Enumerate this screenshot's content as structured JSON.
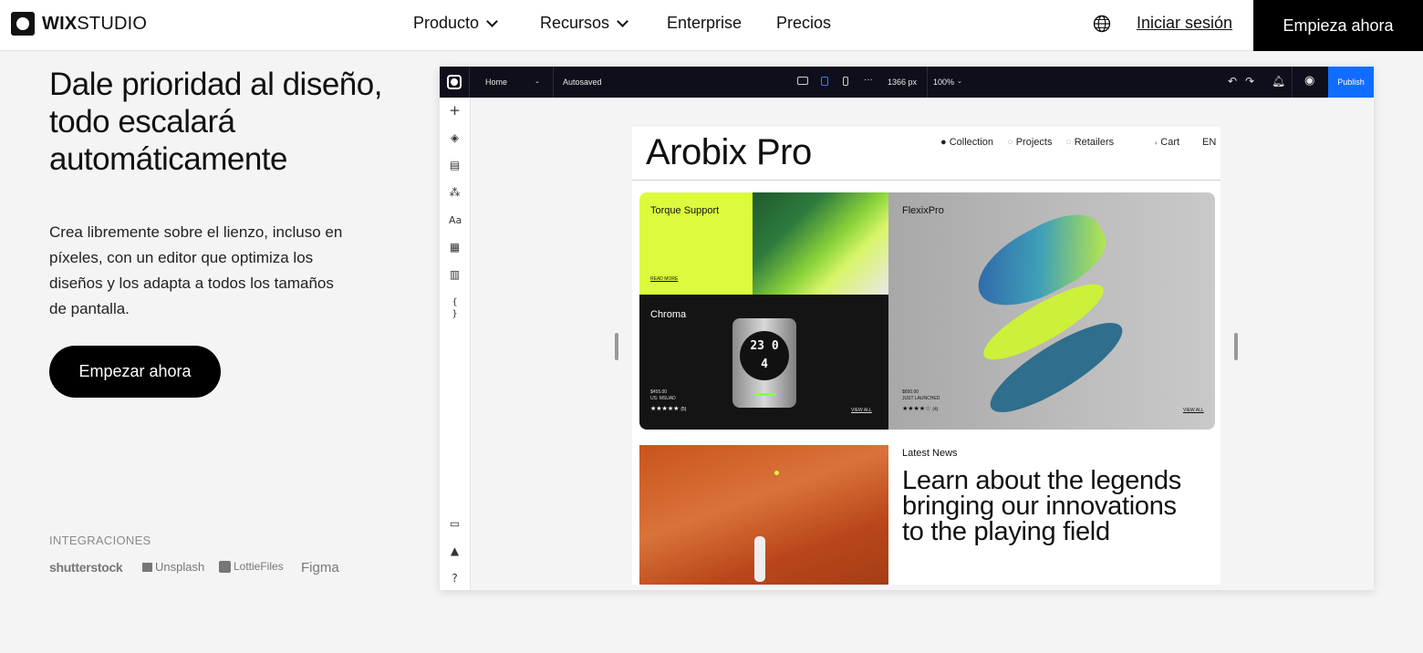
{
  "nav": {
    "logo_bold": "WIX",
    "logo_light": "STUDIO",
    "items": [
      {
        "label": "Producto",
        "has_dropdown": true
      },
      {
        "label": "Recursos",
        "has_dropdown": true
      },
      {
        "label": "Enterprise",
        "has_dropdown": false
      },
      {
        "label": "Precios",
        "has_dropdown": false
      }
    ],
    "login": "Iniciar sesión",
    "cta": "Empieza ahora"
  },
  "hero": {
    "title": "Dale prioridad al diseño, todo escalará automáticamente",
    "description": "Crea libremente sobre el lienzo, incluso en píxeles, con un editor que optimiza los diseños y los adapta a todos los tamaños de pantalla.",
    "button": "Empezar ahora"
  },
  "integrations": {
    "label": "INTEGRACIONES",
    "logos": [
      "shutterstock",
      "Unsplash",
      "LottieFiles",
      "Figma"
    ]
  },
  "editor": {
    "page": "Home",
    "status": "Autosaved",
    "width": "1366 px",
    "zoom": "100%",
    "publish": "Publish",
    "site": {
      "name": "Arobix Pro",
      "menu": [
        "Collection",
        "Projects",
        "Retailers"
      ],
      "cart": "Cart",
      "lang": "EN",
      "cards": {
        "torque": "Torque Support",
        "read_more": "READ MORE",
        "flexix": "FlexixPro",
        "chroma": "Chroma",
        "watch_time": "23 04",
        "chroma_price": "$455.00",
        "chroma_sub": "US: MSUAD",
        "chroma_count": "(5)",
        "flexix_price": "$650.00",
        "flexix_sub": "JUST LAUNCHED",
        "flexix_count": "(4)",
        "view_all": "VIEW ALL"
      },
      "news_label": "Latest News",
      "news_headline": "Learn about the legends bringing our innovations to the playing field"
    }
  },
  "colors": {
    "accent": "#116dff",
    "lime": "#ddfb3c",
    "editor_bar": "#0e0f1a"
  }
}
